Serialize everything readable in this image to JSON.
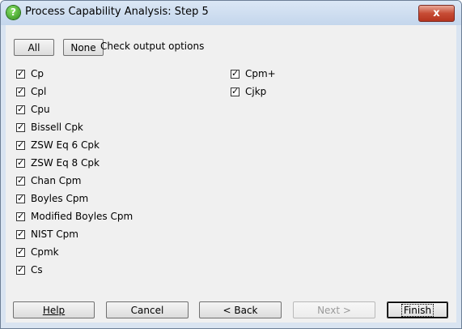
{
  "window": {
    "title": "Process Capability Analysis: Step 5",
    "close_label": "x"
  },
  "toolbar": {
    "all_label": "All",
    "none_label": "None",
    "hint": "Check output options"
  },
  "options": {
    "left": [
      {
        "label": "Cp",
        "checked": true
      },
      {
        "label": "Cpl",
        "checked": true
      },
      {
        "label": "Cpu",
        "checked": true
      },
      {
        "label": "Bissell Cpk",
        "checked": true
      },
      {
        "label": "ZSW Eq 6 Cpk",
        "checked": true
      },
      {
        "label": "ZSW Eq 8 Cpk",
        "checked": true
      },
      {
        "label": "Chan Cpm",
        "checked": true
      },
      {
        "label": "Boyles Cpm",
        "checked": true
      },
      {
        "label": "Modified Boyles Cpm",
        "checked": true
      },
      {
        "label": "NIST Cpm",
        "checked": true
      },
      {
        "label": "Cpmk",
        "checked": true
      },
      {
        "label": "Cs",
        "checked": true
      }
    ],
    "right": [
      {
        "label": "Cpm+",
        "checked": true
      },
      {
        "label": "Cjkp",
        "checked": true
      }
    ]
  },
  "buttons": {
    "help": "Help",
    "cancel": "Cancel",
    "back": "< Back",
    "next": "Next >",
    "finish": "Finish"
  }
}
